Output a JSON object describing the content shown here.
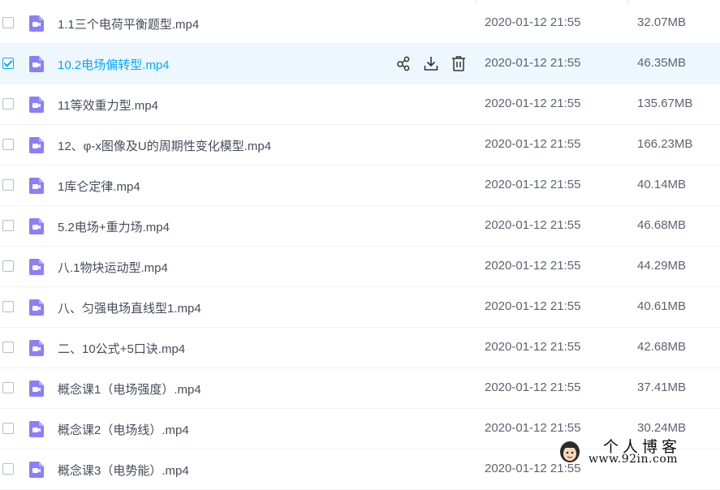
{
  "files": [
    {
      "name": "1.1三个电荷平衡题型.mp4",
      "date": "2020-01-12 21:55",
      "size": "32.07MB",
      "selected": false
    },
    {
      "name": "10.2电场偏转型.mp4",
      "date": "2020-01-12 21:55",
      "size": "46.35MB",
      "selected": true
    },
    {
      "name": "11等效重力型.mp4",
      "date": "2020-01-12 21:55",
      "size": "135.67MB",
      "selected": false
    },
    {
      "name": "12、φ-x图像及U的周期性变化模型.mp4",
      "date": "2020-01-12 21:55",
      "size": "166.23MB",
      "selected": false
    },
    {
      "name": "1库仑定律.mp4",
      "date": "2020-01-12 21:55",
      "size": "40.14MB",
      "selected": false
    },
    {
      "name": "5.2电场+重力场.mp4",
      "date": "2020-01-12 21:55",
      "size": "46.68MB",
      "selected": false
    },
    {
      "name": "八.1物块运动型.mp4",
      "date": "2020-01-12 21:55",
      "size": "44.29MB",
      "selected": false
    },
    {
      "name": "八、匀强电场直线型1.mp4",
      "date": "2020-01-12 21:55",
      "size": "40.61MB",
      "selected": false
    },
    {
      "name": "二、10公式+5口诀.mp4",
      "date": "2020-01-12 21:55",
      "size": "42.68MB",
      "selected": false
    },
    {
      "name": "概念课1（电场强度）.mp4",
      "date": "2020-01-12 21:55",
      "size": "37.41MB",
      "selected": false
    },
    {
      "name": "概念课2（电场线）.mp4",
      "date": "2020-01-12 21:55",
      "size": "30.24MB",
      "selected": false
    },
    {
      "name": "概念课3（电势能）.mp4",
      "date": "2020-01-12 21:55",
      "size": "",
      "selected": false
    }
  ],
  "row_actions": [
    "share-icon",
    "download-icon",
    "delete-icon"
  ],
  "file_icon": "video-file-icon",
  "watermark": {
    "title": "个人博客",
    "url": "www.92in.com"
  },
  "colors": {
    "accent": "#06a7ff",
    "selected_row_bg": "#eef7fe",
    "video_icon": "#8b7ff7",
    "text": "#454d5a"
  }
}
